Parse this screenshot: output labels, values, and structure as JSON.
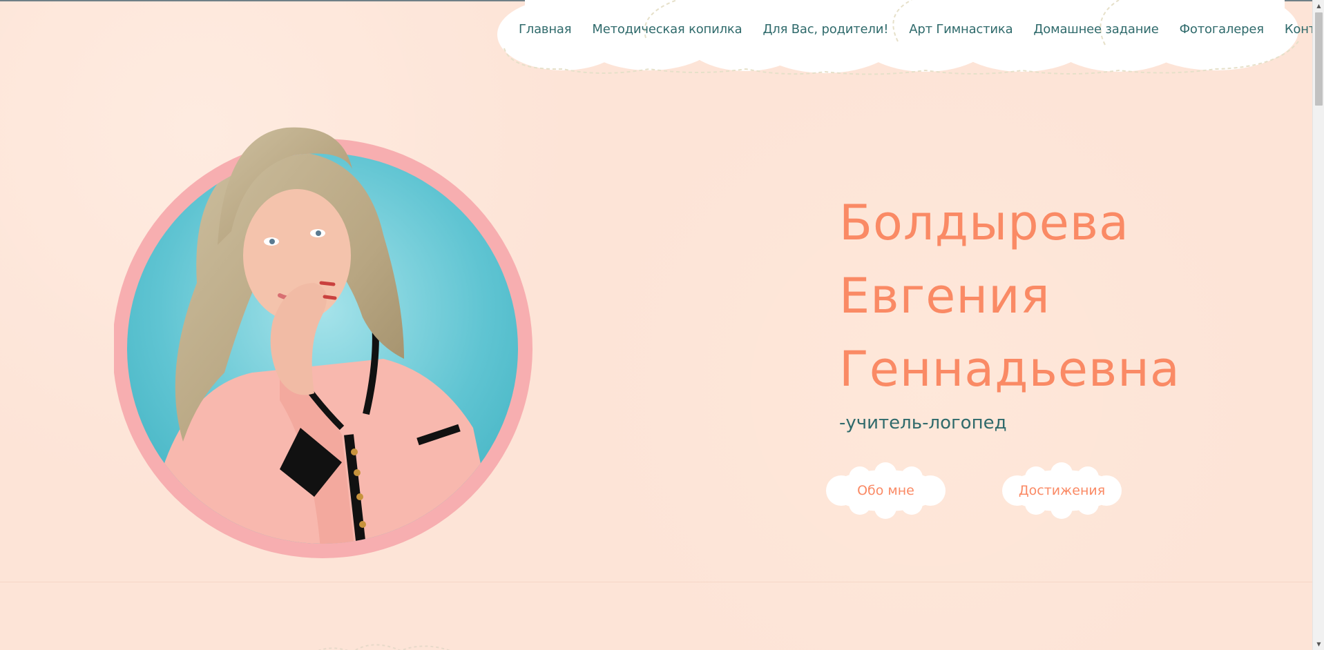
{
  "nav": {
    "items": [
      {
        "label": "Главная"
      },
      {
        "label": "Методическая копилка"
      },
      {
        "label": "Для Вас, родители!"
      },
      {
        "label": "Арт Гимнастика"
      },
      {
        "label": "Домашнее задание"
      },
      {
        "label": "Фотогалерея"
      },
      {
        "label": "Контакты"
      }
    ]
  },
  "hero": {
    "name_line1": "Болдырева",
    "name_line2": "Евгения",
    "name_line3": "Геннадьевна",
    "role": "-учитель-логопед",
    "about_button": "Обо мне",
    "achievements_button": "Достижения"
  },
  "colors": {
    "background": "#fde4d7",
    "accent": "#fa8a65",
    "nav_text": "#2f6a6b",
    "ring": "#f7aeb0",
    "photo_bg": "#64c7d4"
  }
}
